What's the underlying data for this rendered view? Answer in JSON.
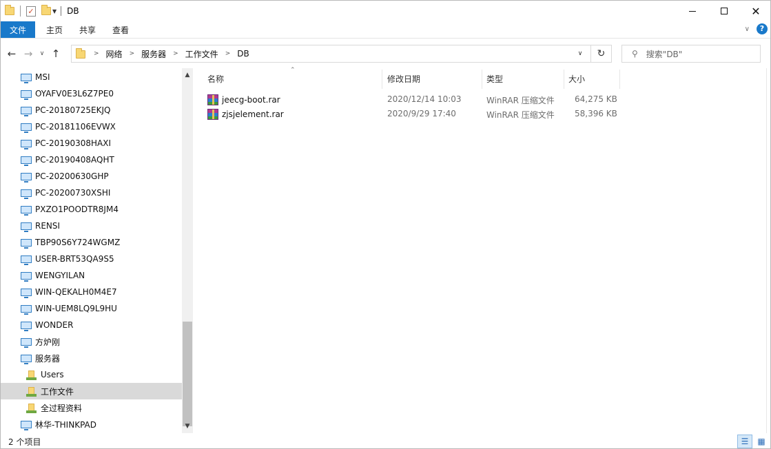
{
  "window": {
    "title": "DB",
    "controls": {
      "minimize": "",
      "maximize": "",
      "close": "✕"
    }
  },
  "ribbon": {
    "tabs": [
      "文件",
      "主页",
      "共享",
      "查看"
    ],
    "help": "?"
  },
  "address": {
    "crumbs": [
      "网络",
      "服务器",
      "工作文件",
      "DB"
    ]
  },
  "search": {
    "placeholder": "搜索\"DB\""
  },
  "nav_pane": {
    "items": [
      {
        "label": "MSI",
        "icon": "computer-icon"
      },
      {
        "label": "OYAFV0E3L6Z7PE0",
        "icon": "computer-icon"
      },
      {
        "label": "PC-20180725EKJQ",
        "icon": "computer-icon"
      },
      {
        "label": "PC-20181106EVWX",
        "icon": "computer-icon"
      },
      {
        "label": "PC-20190308HAXI",
        "icon": "computer-icon"
      },
      {
        "label": "PC-20190408AQHT",
        "icon": "computer-icon"
      },
      {
        "label": "PC-20200630GHP",
        "icon": "computer-icon"
      },
      {
        "label": "PC-20200730XSHI",
        "icon": "computer-icon"
      },
      {
        "label": "PXZO1POODTR8JM4",
        "icon": "computer-icon"
      },
      {
        "label": "RENSI",
        "icon": "computer-icon"
      },
      {
        "label": "TBP90S6Y724WGMZ",
        "icon": "computer-icon"
      },
      {
        "label": "USER-BRT53QA9S5",
        "icon": "computer-icon"
      },
      {
        "label": "WENGYILAN",
        "icon": "computer-icon"
      },
      {
        "label": "WIN-QEKALH0M4E7",
        "icon": "computer-icon"
      },
      {
        "label": "WIN-UEM8LQ9L9HU",
        "icon": "computer-icon"
      },
      {
        "label": "WONDER",
        "icon": "computer-icon"
      },
      {
        "label": "方炉刚",
        "icon": "computer-icon"
      },
      {
        "label": "服务器",
        "icon": "computer-icon"
      },
      {
        "label": "Users",
        "icon": "shared-folder-icon"
      },
      {
        "label": "工作文件",
        "icon": "shared-folder-icon",
        "selected": true
      },
      {
        "label": "全过程资料",
        "icon": "shared-folder-icon"
      },
      {
        "label": "林华-THINKPAD",
        "icon": "computer-icon"
      }
    ]
  },
  "columns": {
    "name": "名称",
    "modified": "修改日期",
    "type": "类型",
    "size": "大小"
  },
  "files": [
    {
      "name": "jeecg-boot.rar",
      "modified": "2020/12/14 10:03",
      "type": "WinRAR 压缩文件",
      "size": "64,275 KB",
      "icon": "winrar-archive-icon"
    },
    {
      "name": "zjsjelement.rar",
      "modified": "2020/9/29 17:40",
      "type": "WinRAR 压缩文件",
      "size": "58,396 KB",
      "icon": "winrar-archive-icon"
    }
  ],
  "status": {
    "item_count": "2 个项目"
  },
  "colors": {
    "accent": "#1979ca",
    "selection": "#d9d9d9"
  }
}
